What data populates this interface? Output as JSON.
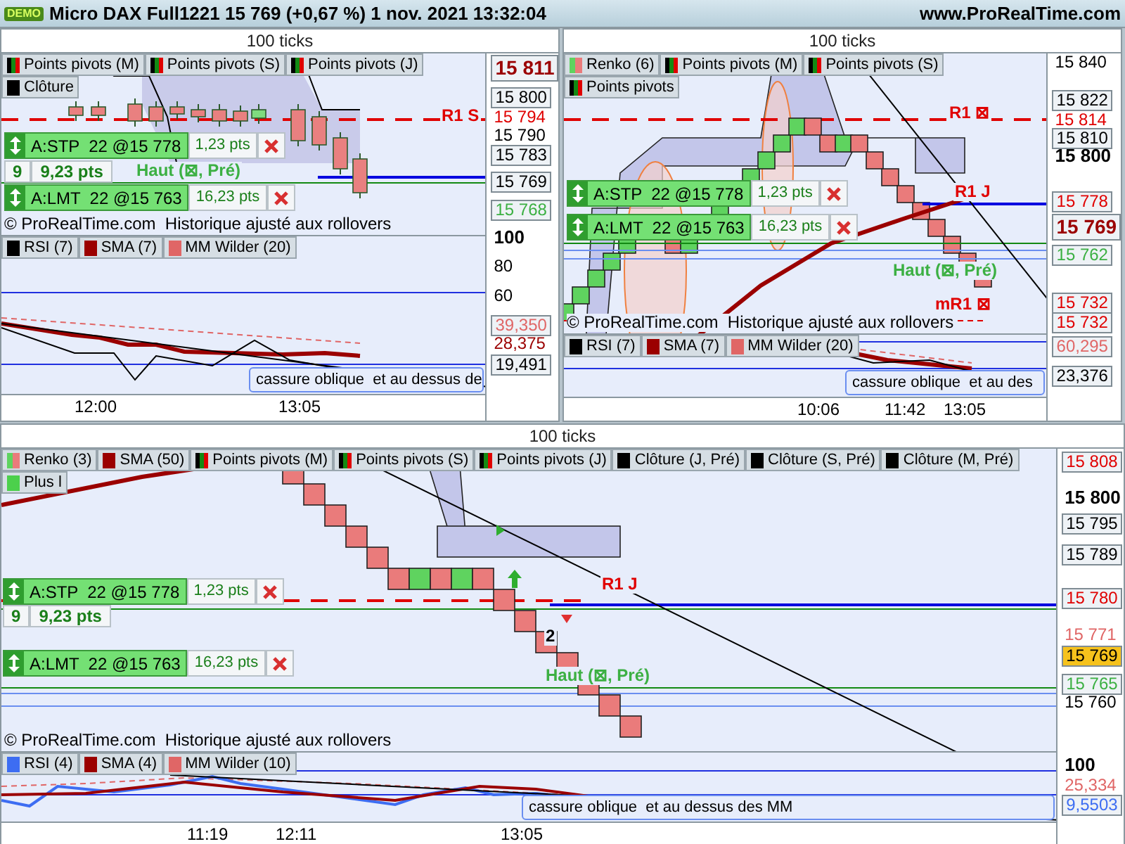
{
  "title_bar": {
    "badge": "DEMO",
    "title": "Micro DAX Full1221 15 769 (+0,67 %) 1 nov. 2021 13:32:04",
    "site": "www.ProRealTime.com"
  },
  "panels": [
    {
      "header": "100 ticks",
      "legend": [
        {
          "label": "Points pivots (M)",
          "kind": "pivot"
        },
        {
          "label": "Points pivots (S)",
          "kind": "pivot"
        },
        {
          "label": "Points pivots (J)",
          "kind": "pivot"
        },
        {
          "label": "Clôture",
          "kind": "solid",
          "color": "#000000"
        }
      ],
      "price_axis": [
        {
          "label": "15 811",
          "kind": "current",
          "color": "#9b0000"
        },
        {
          "label": "15 800",
          "kind": "boxed"
        },
        {
          "label": "15 794",
          "kind": "plain",
          "color": "#e00000"
        },
        {
          "label": "15 790",
          "kind": "plain"
        },
        {
          "label": "15 783",
          "kind": "boxed"
        },
        {
          "label": "15 769",
          "kind": "boxed"
        },
        {
          "label": "15 768",
          "kind": "boxed",
          "color": "#3cb043"
        }
      ],
      "orders": [
        {
          "label": "A:STP  22 @15 778",
          "points": "1,23 pts"
        },
        {
          "label": "A:LMT  22 @15 763",
          "points": "16,23 pts"
        }
      ],
      "position": {
        "quantity": "9",
        "points": "9,23 pts"
      },
      "annotations": [
        {
          "text": "R1 S",
          "color": "#e00000"
        },
        {
          "text": "Haut (⊠, Pré)",
          "color": "#3cb043"
        }
      ],
      "copyright": "© ProRealTime.com  Historique ajusté aux rollovers",
      "indicator": {
        "legend": [
          {
            "label": "RSI (7)",
            "kind": "solid",
            "color": "#000000"
          },
          {
            "label": "SMA (7)",
            "kind": "solid",
            "color": "#9b0000"
          },
          {
            "label": "MM Wilder (20)",
            "kind": "solid",
            "color": "#e06666"
          }
        ],
        "axis": [
          {
            "label": "100",
            "kind": "bold"
          },
          {
            "label": "80",
            "kind": "plain"
          },
          {
            "label": "60",
            "kind": "plain"
          },
          {
            "label": "39,350",
            "kind": "boxed",
            "color": "#e06666"
          },
          {
            "label": "28,375",
            "kind": "plain",
            "color": "#9b0000"
          },
          {
            "label": "19,491",
            "kind": "boxed"
          }
        ],
        "note": "cassure oblique  et au dessus de"
      },
      "time_axis": [
        "12:00",
        "13:05"
      ]
    },
    {
      "header": "100 ticks",
      "legend": [
        {
          "label": "Renko (6)",
          "kind": "renko"
        },
        {
          "label": "Points pivots (M)",
          "kind": "pivot"
        },
        {
          "label": "Points pivots (S)",
          "kind": "pivot"
        },
        {
          "label": "Points pivots",
          "kind": "pivot"
        }
      ],
      "price_axis": [
        {
          "label": "15 840",
          "kind": "plain"
        },
        {
          "label": "15 822",
          "kind": "boxed"
        },
        {
          "label": "15 814",
          "kind": "plain",
          "color": "#e00000"
        },
        {
          "label": "15 810",
          "kind": "boxed"
        },
        {
          "label": "15 800",
          "kind": "bold"
        },
        {
          "label": "15 778",
          "kind": "boxed",
          "color": "#e00000"
        },
        {
          "label": "15 769",
          "kind": "current",
          "color": "#9b0000"
        },
        {
          "label": "15 762",
          "kind": "boxed",
          "color": "#3cb043"
        },
        {
          "label": "15 732",
          "kind": "boxed",
          "color": "#e00000"
        },
        {
          "label": "15 732",
          "kind": "boxed",
          "color": "#e00000"
        }
      ],
      "orders": [
        {
          "label": "A:STP  22 @15 778",
          "points": "1,23 pts"
        },
        {
          "label": "A:LMT  22 @15 763",
          "points": "16,23 pts"
        }
      ],
      "annotations": [
        {
          "text": "R1 ⊠",
          "color": "#e00000"
        },
        {
          "text": "R1 J",
          "color": "#e00000"
        },
        {
          "text": "Haut (⊠, Pré)",
          "color": "#3cb043"
        },
        {
          "text": "mR1 ⊠",
          "color": "#e00000"
        }
      ],
      "copyright": "© ProRealTime.com  Historique ajusté aux rollovers",
      "indicator": {
        "legend": [
          {
            "label": "RSI (7)",
            "kind": "solid",
            "color": "#000000"
          },
          {
            "label": "SMA (7)",
            "kind": "solid",
            "color": "#9b0000"
          },
          {
            "label": "MM Wilder (20)",
            "kind": "solid",
            "color": "#e06666"
          }
        ],
        "axis": [
          {
            "label": "60,295",
            "kind": "boxed",
            "color": "#e06666"
          },
          {
            "label": "23,376",
            "kind": "boxed"
          }
        ],
        "note": "cassure oblique  et au des"
      },
      "time_axis": [
        "10:06",
        "11:42",
        "13:05"
      ]
    },
    {
      "header": "100 ticks",
      "legend": [
        {
          "label": "Renko (3)",
          "kind": "renko"
        },
        {
          "label": "SMA (50)",
          "kind": "solid",
          "color": "#9b0000"
        },
        {
          "label": "Points pivots (M)",
          "kind": "pivot"
        },
        {
          "label": "Points pivots (S)",
          "kind": "pivot"
        },
        {
          "label": "Points pivots (J)",
          "kind": "pivot"
        },
        {
          "label": "Clôture (J, Pré)",
          "kind": "solid",
          "color": "#000000"
        },
        {
          "label": "Clôture (S, Pré)",
          "kind": "solid",
          "color": "#000000"
        },
        {
          "label": "Clôture (M, Pré)",
          "kind": "solid",
          "color": "#000000"
        },
        {
          "label": "Plus l",
          "kind": "solid",
          "color": "#4cd04c"
        }
      ],
      "price_axis": [
        {
          "label": "15 808",
          "kind": "boxed",
          "color": "#e00000"
        },
        {
          "label": "15 800",
          "kind": "bold"
        },
        {
          "label": "15 795",
          "kind": "boxed"
        },
        {
          "label": "15 789",
          "kind": "boxed"
        },
        {
          "label": "15 780",
          "kind": "boxed",
          "color": "#e00000"
        },
        {
          "label": "15 771",
          "kind": "plain",
          "color": "#e06666"
        },
        {
          "label": "15 769",
          "kind": "highlight"
        },
        {
          "label": "15 765",
          "kind": "boxed",
          "color": "#3cb043"
        },
        {
          "label": "15 760",
          "kind": "plain"
        }
      ],
      "orders": [
        {
          "label": "A:STP  22 @15 778",
          "points": "1,23 pts"
        },
        {
          "label": "A:LMT  22 @15 763",
          "points": "16,23 pts"
        }
      ],
      "position": {
        "quantity": "9",
        "points": "9,23 pts"
      },
      "annotations": [
        {
          "text": "R1 J",
          "color": "#e00000"
        },
        {
          "text": "Haut (⊠, Pré)",
          "color": "#3cb043"
        },
        {
          "text": "2",
          "color": "#000000"
        }
      ],
      "copyright": "© ProRealTime.com  Historique ajusté aux rollovers",
      "indicator": {
        "legend": [
          {
            "label": "RSI (4)",
            "kind": "solid",
            "color": "#3d6df2"
          },
          {
            "label": "SMA (4)",
            "kind": "solid",
            "color": "#9b0000"
          },
          {
            "label": "MM Wilder (10)",
            "kind": "solid",
            "color": "#e06666"
          }
        ],
        "axis": [
          {
            "label": "100",
            "kind": "bold"
          },
          {
            "label": "25,334",
            "kind": "plain",
            "color": "#e06666"
          },
          {
            "label": "9,5503",
            "kind": "boxed",
            "color": "#3d6df2"
          }
        ],
        "note": "cassure oblique  et au dessus des MM"
      },
      "time_axis": [
        "11:19",
        "12:11",
        "13:05"
      ]
    }
  ]
}
